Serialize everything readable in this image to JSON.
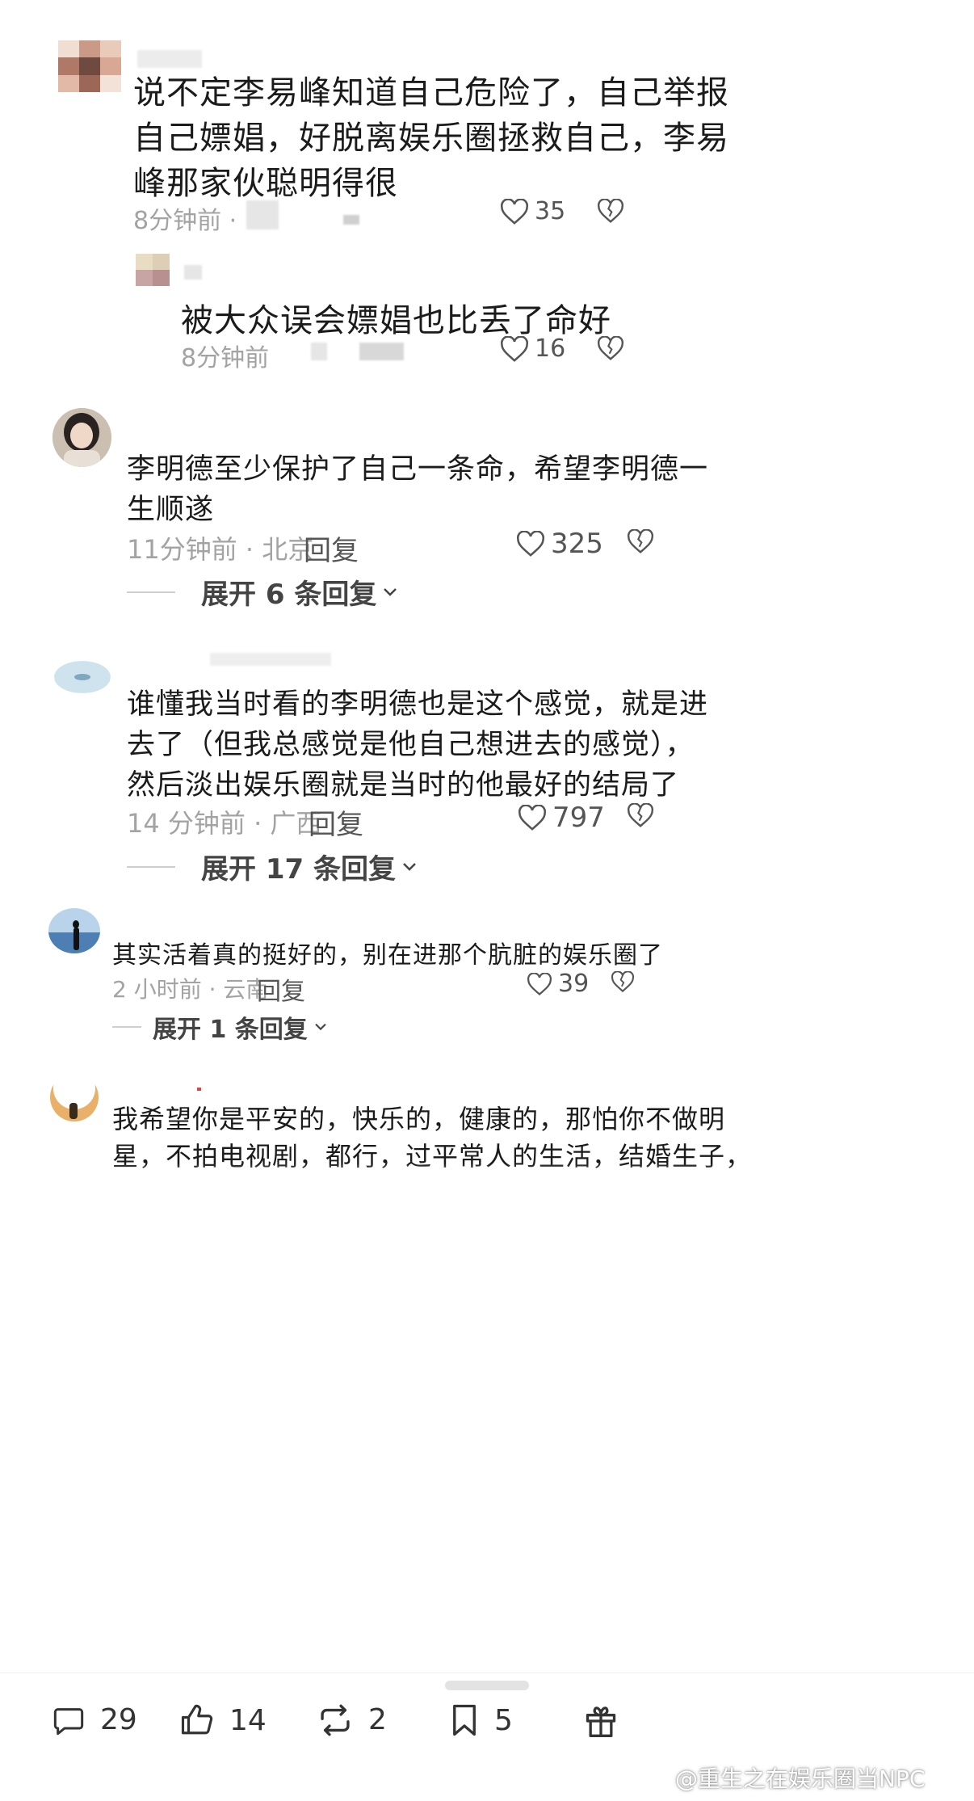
{
  "comments": [
    {
      "text_lines": [
        "说不定李易峰知道自己危险了，自己举报",
        "自己嫖娼，好脱离娱乐圈拯救自己，李易",
        "峰那家伙聪明得很"
      ],
      "time": "8分钟前 ·",
      "likes": "35"
    },
    {
      "text_lines": [
        "被大众误会嫖娼也比丢了命好"
      ],
      "time": "8分钟前",
      "likes": "16"
    },
    {
      "text_lines": [
        "李明德至少保护了自己一条命，希望李明德一",
        "生顺遂"
      ],
      "time": "11分钟前 · 北京",
      "reply": "回复",
      "likes": "325",
      "expand": "展开 6 条回复"
    },
    {
      "text_lines": [
        "谁懂我当时看的李明德也是这个感觉，就是进",
        "去了（但我总感觉是他自己想进去的感觉），",
        "然后淡出娱乐圈就是当时的他最好的结局了"
      ],
      "time": "14 分钟前 · 广西",
      "reply": "回复",
      "likes": "797",
      "expand": "展开 17 条回复"
    },
    {
      "text_lines": [
        "其实活着真的挺好的，别在进那个肮脏的娱乐圈了"
      ],
      "time": "2 小时前 · 云南",
      "reply": "回复",
      "likes": "39",
      "expand": "展开 1 条回复"
    },
    {
      "text_lines": [
        "我希望你是平安的，快乐的，健康的，那怕你不做明",
        "星，不拍电视剧，都行，过平常人的生活，结婚生子，"
      ]
    }
  ],
  "bottom_bar": {
    "comments_count": "29",
    "likes_count": "14",
    "reposts_count": "2",
    "favorites_count": "5"
  },
  "watermark": "@重生之在娱乐圈当NPC",
  "icons": {
    "like": "heart-outline-icon",
    "dislike": "broken-heart-icon",
    "expand": "chevron-down-icon",
    "comment": "comment-bubble-icon",
    "thumb": "thumbs-up-icon",
    "repost": "repost-icon",
    "favorite": "bookmark-icon",
    "gift": "gift-icon"
  }
}
